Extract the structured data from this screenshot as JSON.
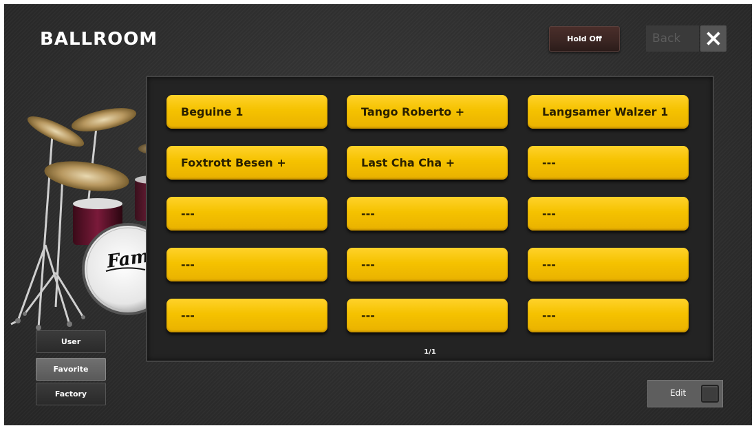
{
  "header": {
    "title": "BALLROOM",
    "hold_label": "Hold Off",
    "back_label": "Back",
    "close_icon": "close-icon"
  },
  "slots": [
    "Beguine 1",
    "Tango Roberto +",
    "Langsamer Walzer 1",
    "Foxtrott Besen +",
    "Last Cha Cha +",
    "---",
    "---",
    "---",
    "---",
    "---",
    "---",
    "---",
    "---",
    "---",
    "---"
  ],
  "page_indicator": "1/1",
  "sidebar": {
    "user": "User",
    "favorite": "Favorite",
    "factory": "Factory",
    "selected": "Favorite"
  },
  "edit": {
    "label": "Edit",
    "active": false
  },
  "decor": {
    "logo_text": "Fame",
    "image": "drum-kit-image"
  },
  "colors": {
    "slot": "#f5c200",
    "background": "#2e2e2e"
  }
}
